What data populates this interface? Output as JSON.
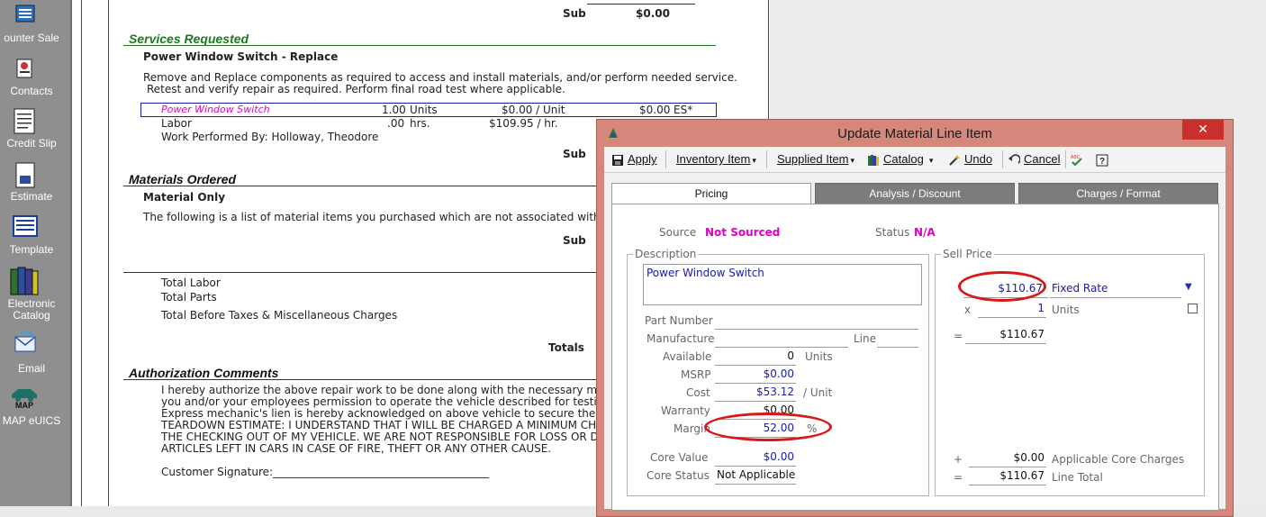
{
  "sidebar": {
    "items": [
      {
        "label": "ounter Sale",
        "icon": "counter-sale-icon"
      },
      {
        "label": "Contacts",
        "icon": "contacts-icon"
      },
      {
        "label": "Credit Slip",
        "icon": "credit-slip-icon"
      },
      {
        "label": "Estimate",
        "icon": "estimate-icon"
      },
      {
        "label": "Template",
        "icon": "template-icon"
      },
      {
        "label": "Electronic\nCatalog",
        "icon": "electronic-catalog-icon"
      },
      {
        "label": "Email",
        "icon": "email-icon"
      },
      {
        "label": "MAP eUICS",
        "icon": "map-euics-icon"
      }
    ]
  },
  "document": {
    "top_sub_label": "Sub",
    "top_sub_value": "$0.00",
    "services_heading": "Services Requested",
    "service_title": "Power Window Switch - Replace",
    "service_desc_1": "Remove and Replace components as required to access and install materials, and/or perform needed service.",
    "service_desc_2": "Retest and verify repair as required.  Perform final road test where applicable.",
    "line_item": {
      "name": "Power Window Switch",
      "qty": "1.00",
      "unit": "Units",
      "price": "$0.00 / Unit",
      "total": "$0.00",
      "flag": "ES*"
    },
    "labor_row": {
      "name": "Labor",
      "qty": ".00",
      "unit": "hrs.",
      "rate": "$109.95 / hr."
    },
    "performed_by": "Work Performed By: Holloway, Theodore",
    "sub_label": "Sub",
    "materials_heading": "Materials Ordered",
    "material_title": "Material Only",
    "material_desc": "The following is a list of material items you purchased which are not associated with ser",
    "sub_label2": "Sub",
    "total_labor": "Total Labor",
    "total_parts": "Total Parts",
    "total_before_taxes": "Total Before Taxes & Miscellaneous Charges",
    "totals": "Totals",
    "auth_heading": "Authorization Comments",
    "auth_lines": [
      "I hereby authorize the above repair work to be done along with the necessary mater",
      "you and/or your employees permission to operate the vehicle described for testing a",
      "Express mechanic's lien is hereby acknowledged on above vehicle to secure the amo",
      "TEARDOWN ESTIMATE: I UNDERSTAND THAT I WILL BE CHARGED A MINIMUM CHAR",
      "THE CHECKING OUT OF MY VEHICLE. WE ARE NOT RESPONSIBLE FOR LOSS OR DAN",
      "ARTICLES LEFT IN CARS IN CASE OF FIRE, THEFT OR ANY OTHER CAUSE."
    ],
    "signature_label": "Customer Signature:________________________________________"
  },
  "dialog": {
    "title": "Update Material Line Item",
    "close": "✕",
    "toolbar": {
      "apply": "Apply",
      "inventory_item": "Inventory Item",
      "supplied_item": "Supplied Item",
      "catalog": "Catalog",
      "undo": "Undo",
      "cancel": "Cancel"
    },
    "tabs": [
      "Pricing",
      "Analysis / Discount",
      "Charges / Format"
    ],
    "pricing": {
      "source_label": "Source",
      "source_value": "Not Sourced",
      "status_label": "Status",
      "status_value": "N/A",
      "description_group": "Description",
      "description_value": "Power Window Switch",
      "part_number_label": "Part Number",
      "part_number_value": "",
      "manufacture_label": "Manufacture",
      "manufacture_value": "",
      "line_label": "Line",
      "line_value": "",
      "available_label": "Available",
      "available_value": "0",
      "available_unit": "Units",
      "msrp_label": "MSRP",
      "msrp_value": "$0.00",
      "cost_label": "Cost",
      "cost_value": "$53.12",
      "cost_unit": "/ Unit",
      "warranty_label": "Warranty",
      "warranty_value": "$0.00",
      "margin_label": "Margin",
      "margin_value": "52.00",
      "margin_unit": "%",
      "core_value_label": "Core Value",
      "core_value_value": "$0.00",
      "core_status_label": "Core Status",
      "core_status_value": "Not Applicable",
      "sell_price_group": "Sell Price",
      "sell_price_value": "$110.67",
      "sell_price_mode": "Fixed Rate",
      "times_symbol": "x",
      "qty_value": "1",
      "qty_unit": "Units",
      "equals_symbol": "=",
      "ext_value": "$110.67",
      "plus_symbol": "+",
      "core_charges_value": "$0.00",
      "core_charges_label": "Applicable Core Charges",
      "line_total_value": "$110.67",
      "line_total_label": "Line Total"
    }
  },
  "colors": {
    "dialog_frame": "#d4877a",
    "accent_magenta": "#e000c8",
    "value_blue": "#1a1aa8",
    "highlight_red": "#d81818"
  }
}
